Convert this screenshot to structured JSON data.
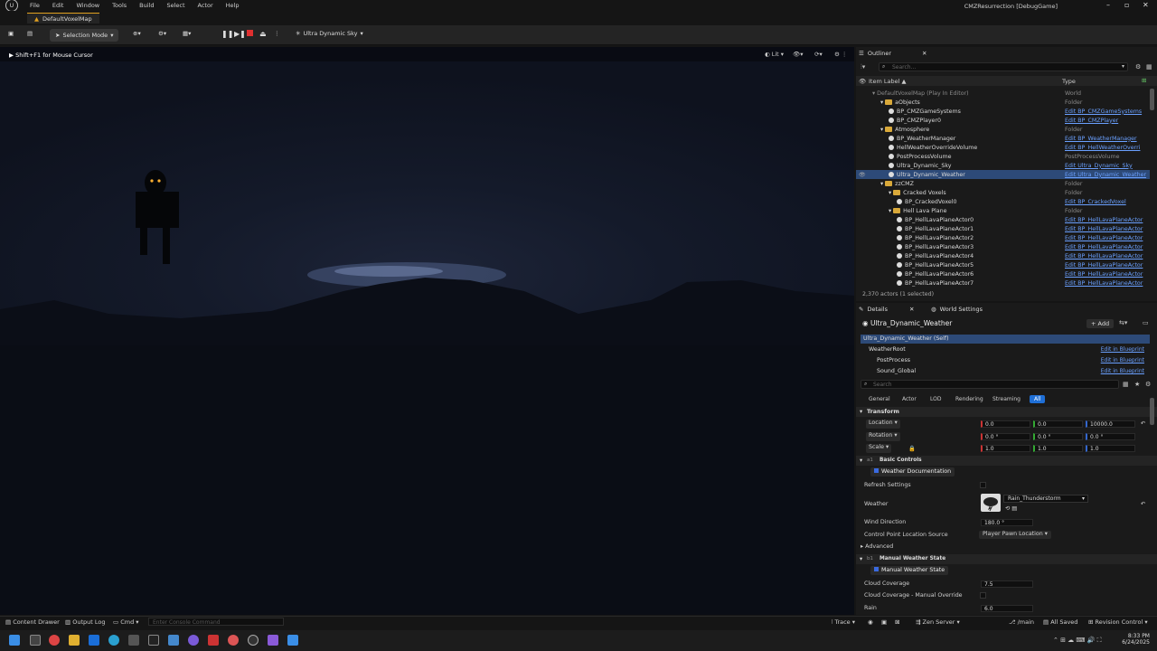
{
  "menu": [
    "File",
    "Edit",
    "Window",
    "Tools",
    "Build",
    "Select",
    "Actor",
    "Help"
  ],
  "window_title": "CMZResurrection [DebugGame]",
  "doc_tab": "DefaultVoxelMap",
  "toolbar": {
    "selection_mode": "Selection Mode",
    "sky_label": "Ultra Dynamic Sky"
  },
  "viewport": {
    "hint": "Shift+F1 for Mouse Cursor",
    "lit": "Lit"
  },
  "outliner": {
    "tab": "Outliner",
    "search_placeholder": "Search...",
    "col_label": "Item Label ▲",
    "col_type": "Type",
    "rows": [
      {
        "label": "DefaultVoxelMap (Play In Editor)",
        "type": "World",
        "indent": 0,
        "kind": "world",
        "link": false
      },
      {
        "label": "aObjects",
        "type": "Folder",
        "indent": 1,
        "kind": "folder",
        "link": false
      },
      {
        "label": "BP_CMZGameSystems",
        "type": "Edit BP_CMZGameSystems",
        "indent": 2,
        "kind": "bp",
        "link": true
      },
      {
        "label": "BP_CMZPlayer0",
        "type": "Edit BP_CMZPlayer",
        "indent": 2,
        "kind": "bp",
        "link": true
      },
      {
        "label": "Atmosphere",
        "type": "Folder",
        "indent": 1,
        "kind": "folder",
        "link": false
      },
      {
        "label": "BP_WeatherManager",
        "type": "Edit BP_WeatherManager",
        "indent": 2,
        "kind": "bp",
        "link": true
      },
      {
        "label": "HellWeatherOverrideVolume",
        "type": "Edit BP_HellWeatherOverri",
        "indent": 2,
        "kind": "bp",
        "link": true
      },
      {
        "label": "PostProcessVolume",
        "type": "PostProcessVolume",
        "indent": 2,
        "kind": "bp",
        "link": false
      },
      {
        "label": "Ultra_Dynamic_Sky",
        "type": "Edit Ultra_Dynamic_Sky",
        "indent": 2,
        "kind": "bp",
        "link": true
      },
      {
        "label": "Ultra_Dynamic_Weather",
        "type": "Edit Ultra_Dynamic_Weather",
        "indent": 2,
        "kind": "bp",
        "link": true,
        "selected": true
      },
      {
        "label": "zzCMZ",
        "type": "Folder",
        "indent": 1,
        "kind": "folder",
        "link": false
      },
      {
        "label": "Cracked Voxels",
        "type": "Folder",
        "indent": 2,
        "kind": "folder",
        "link": false
      },
      {
        "label": "BP_CrackedVoxel0",
        "type": "Edit BP_CrackedVoxel",
        "indent": 3,
        "kind": "bp",
        "link": true
      },
      {
        "label": "Hell Lava Plane",
        "type": "Folder",
        "indent": 2,
        "kind": "folder",
        "link": false
      },
      {
        "label": "BP_HellLavaPlaneActor0",
        "type": "Edit BP_HellLavaPlaneActor",
        "indent": 3,
        "kind": "bp",
        "link": true
      },
      {
        "label": "BP_HellLavaPlaneActor1",
        "type": "Edit BP_HellLavaPlaneActor",
        "indent": 3,
        "kind": "bp",
        "link": true
      },
      {
        "label": "BP_HellLavaPlaneActor2",
        "type": "Edit BP_HellLavaPlaneActor",
        "indent": 3,
        "kind": "bp",
        "link": true
      },
      {
        "label": "BP_HellLavaPlaneActor3",
        "type": "Edit BP_HellLavaPlaneActor",
        "indent": 3,
        "kind": "bp",
        "link": true
      },
      {
        "label": "BP_HellLavaPlaneActor4",
        "type": "Edit BP_HellLavaPlaneActor",
        "indent": 3,
        "kind": "bp",
        "link": true
      },
      {
        "label": "BP_HellLavaPlaneActor5",
        "type": "Edit BP_HellLavaPlaneActor",
        "indent": 3,
        "kind": "bp",
        "link": true
      },
      {
        "label": "BP_HellLavaPlaneActor6",
        "type": "Edit BP_HellLavaPlaneActor",
        "indent": 3,
        "kind": "bp",
        "link": true
      },
      {
        "label": "BP_HellLavaPlaneActor7",
        "type": "Edit BP_HellLavaPlaneActor",
        "indent": 3,
        "kind": "bp",
        "link": true
      }
    ],
    "count": "2,370 actors (1 selected)"
  },
  "details": {
    "tab": "Details",
    "world_settings_tab": "World Settings",
    "actor_name": "Ultra_Dynamic_Weather",
    "add_label": "+ Add",
    "components": [
      {
        "label": "Ultra_Dynamic_Weather (Self)",
        "action": ""
      },
      {
        "label": "WeatherRoot",
        "action": "Edit in Blueprint"
      },
      {
        "label": "PostProcess",
        "action": "Edit in Blueprint"
      },
      {
        "label": "Sound_Global",
        "action": "Edit in Blueprint"
      }
    ],
    "search_placeholder": "Search",
    "filters": [
      "General",
      "Actor",
      "LOD",
      "Rendering",
      "Streaming",
      "All"
    ],
    "transform": {
      "title": "Transform",
      "location_label": "Location",
      "location": [
        "0.0",
        "0.0",
        "10000.0"
      ],
      "rotation_label": "Rotation",
      "rotation": [
        "0.0 °",
        "0.0 °",
        "0.0 °"
      ],
      "scale_label": "Scale",
      "scale": [
        "1.0",
        "1.0",
        "1.0"
      ]
    },
    "basic_controls": "Basic Controls",
    "cat_prefix_1": "a1",
    "weather_doc": "Weather Documentation",
    "refresh_settings": "Refresh Settings",
    "weather_label": "Weather",
    "weather_value": "Rain_Thunderstorm",
    "wind_direction_label": "Wind Direction",
    "wind_direction": "180.0 °",
    "control_point_label": "Control Point Location Source",
    "control_point_value": "Player Pawn Location",
    "advanced": "Advanced",
    "manual_weather": "Manual Weather State",
    "cat_prefix_2": "b1",
    "manual_weather_btn": "Manual Weather State",
    "cloud_coverage_label": "Cloud Coverage",
    "cloud_coverage": "7.5",
    "cloud_manual_label": "Cloud Coverage - Manual Override",
    "rain_label": "Rain",
    "rain": "6.0"
  },
  "statusbar": {
    "content_drawer": "Content Drawer",
    "output_log": "Output Log",
    "cmd": "Cmd",
    "console_placeholder": "Enter Console Command",
    "trace": "Trace",
    "zen_server": "Zen Server",
    "branch": "/main",
    "all_saved": "All Saved",
    "revision": "Revision Control"
  },
  "taskbar": {
    "time": "8:33 PM",
    "date": "6/24/2025"
  },
  "colors": {
    "accent": "#2d4a78",
    "link": "#6aa0ff",
    "folder": "#d9a93a",
    "record": "#e03030"
  }
}
